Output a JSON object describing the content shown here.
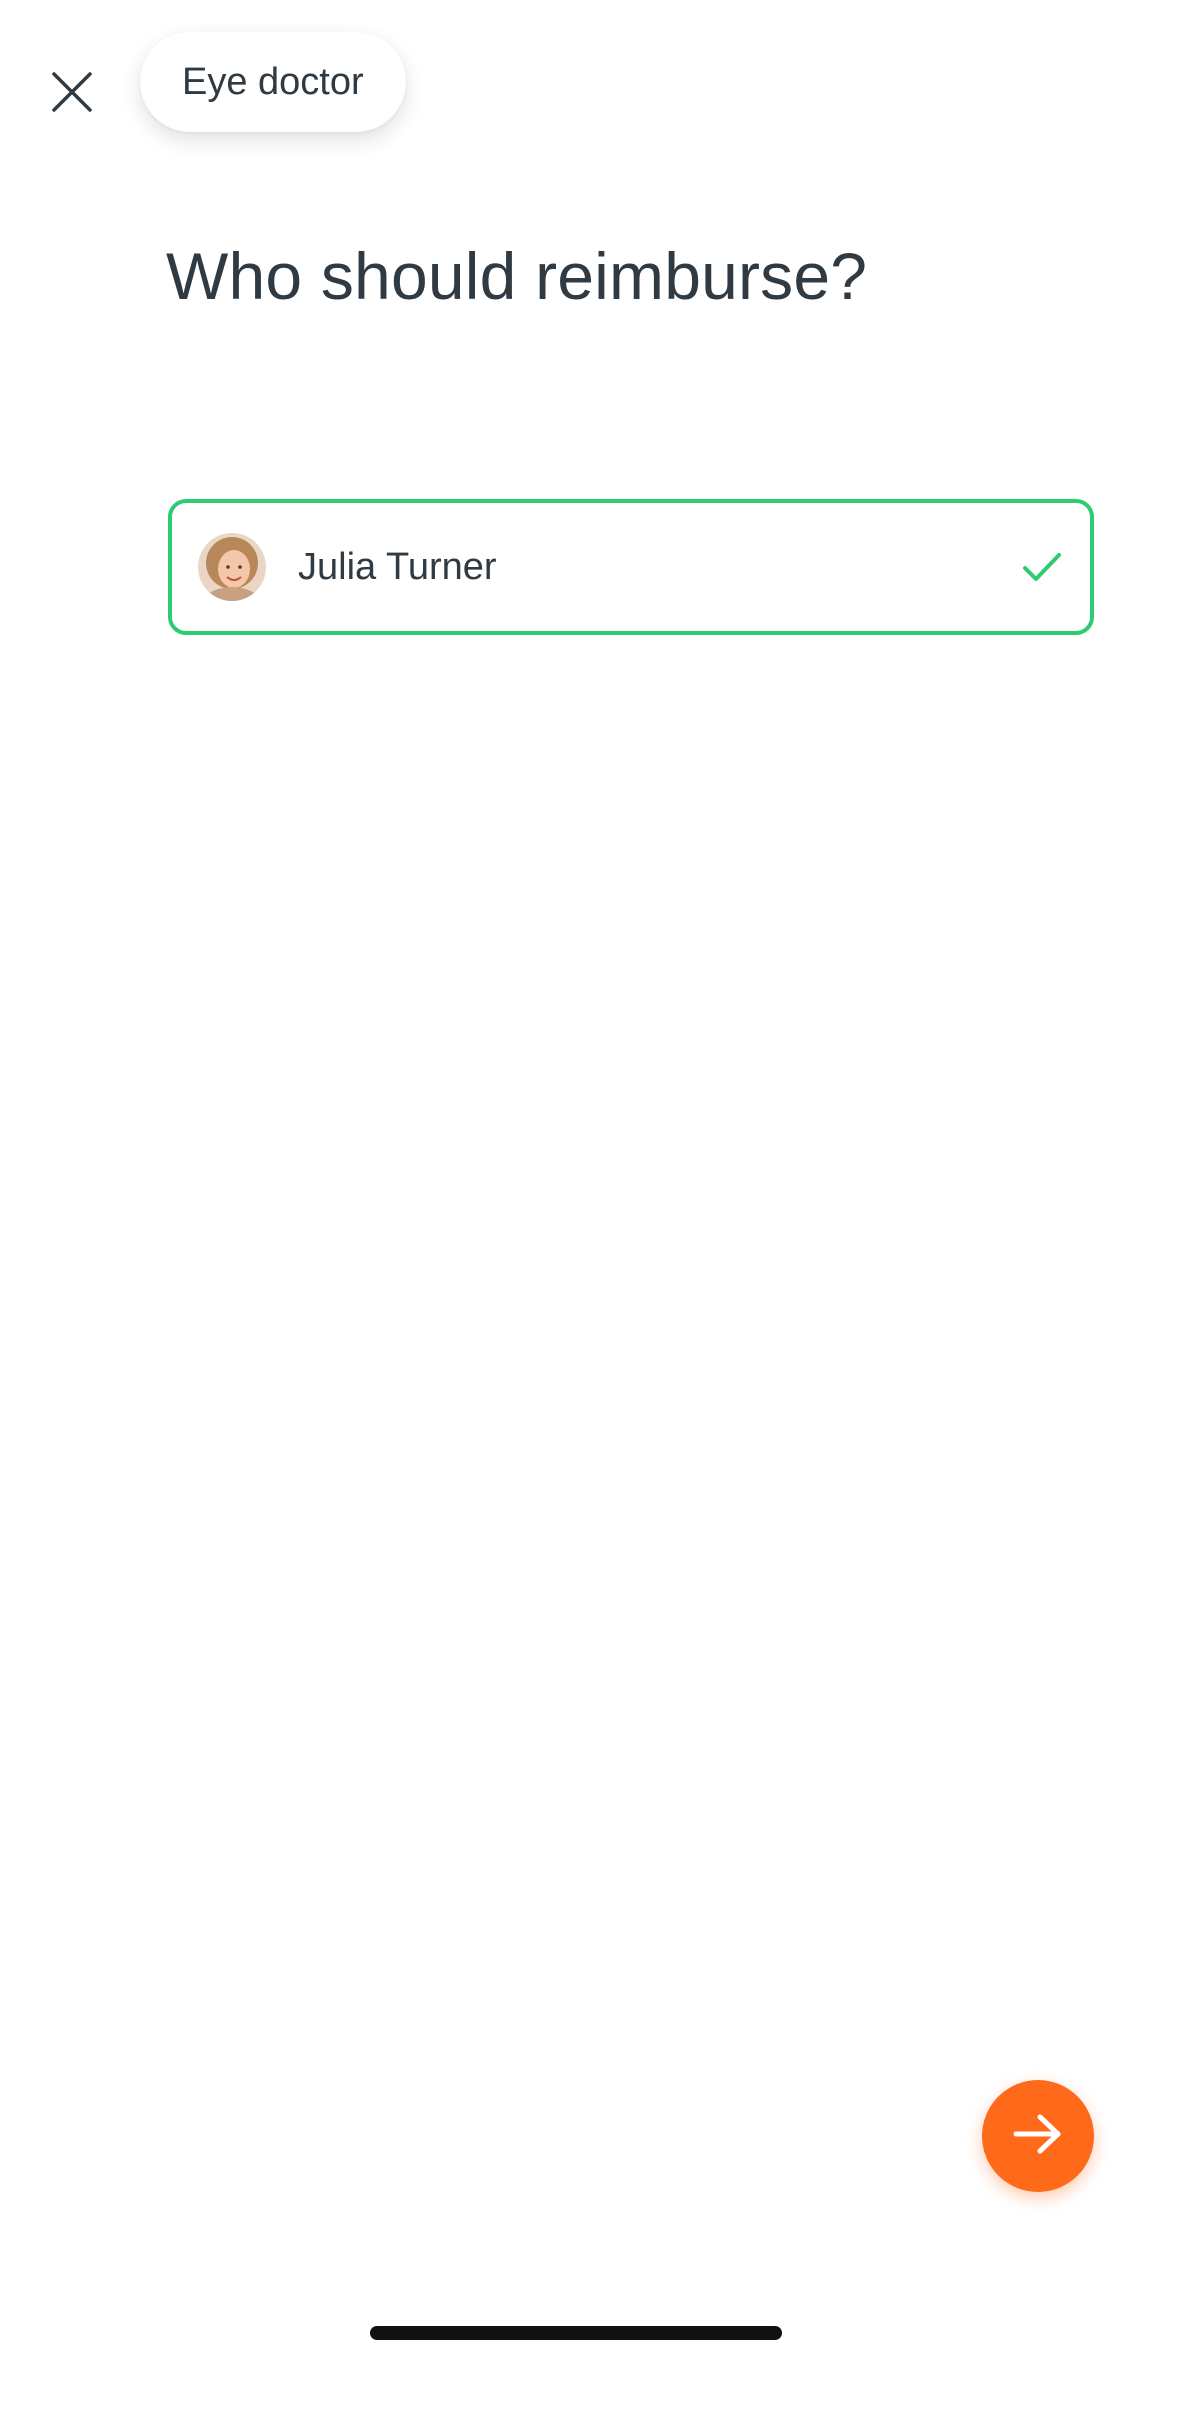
{
  "header": {
    "close_icon": "close-icon",
    "category_label": "Eye doctor"
  },
  "main": {
    "title": "Who should reimburse?",
    "options": [
      {
        "name": "Julia Turner",
        "selected": true,
        "avatar_icon": "avatar",
        "check_icon": "checkmark-icon"
      }
    ]
  },
  "footer": {
    "next_icon": "arrow-right-icon"
  },
  "colors": {
    "selected_border": "#2ecc71",
    "accent": "#ff6a1a",
    "text": "#2f3a43"
  }
}
